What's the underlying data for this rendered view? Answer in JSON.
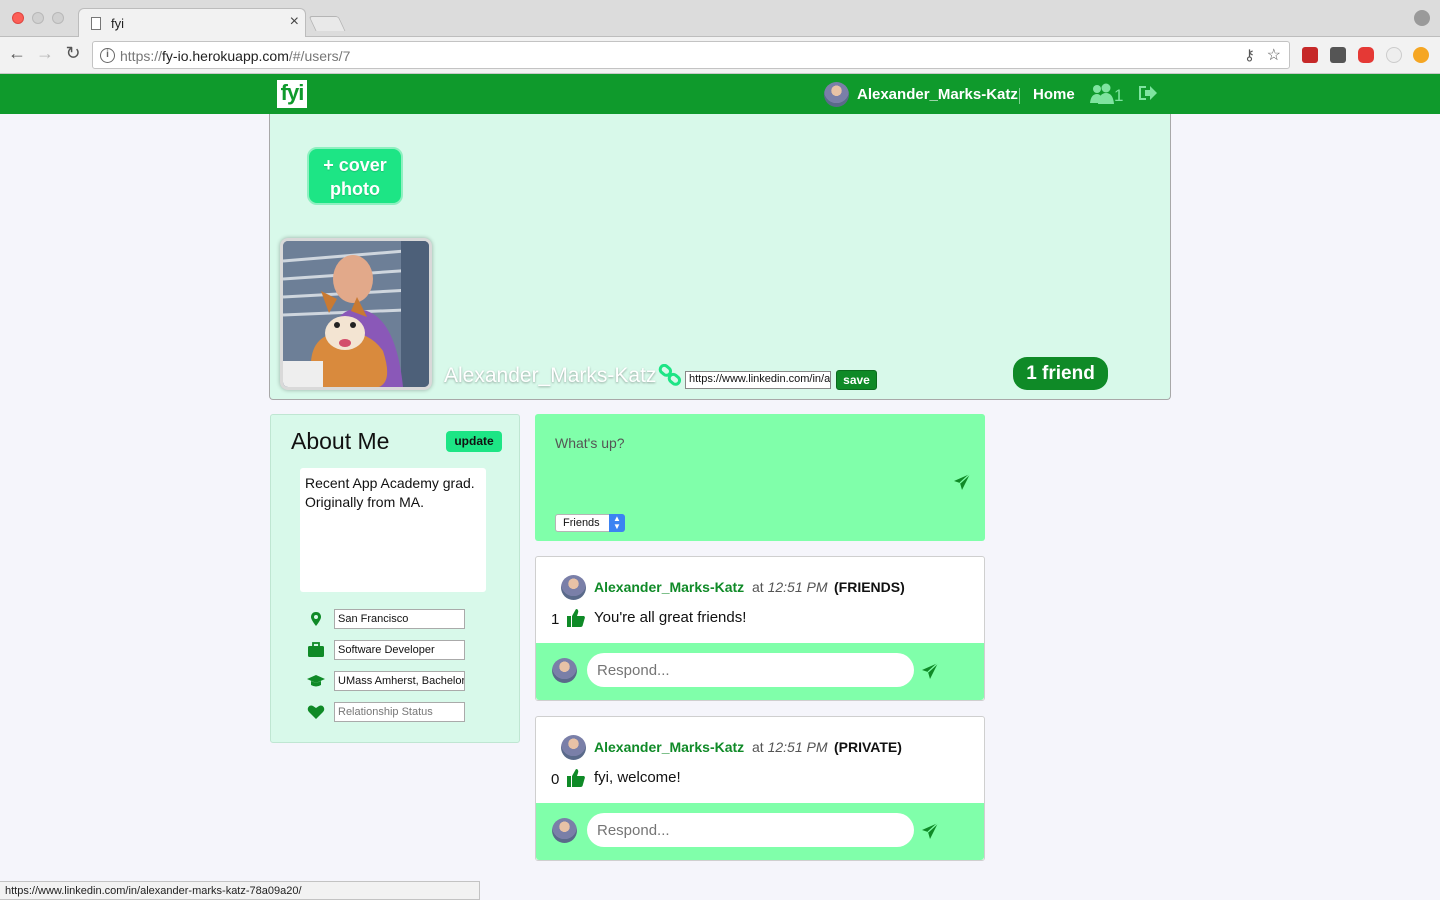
{
  "browser": {
    "tab_title": "fyi",
    "tab_close": "×",
    "url_scheme": "https://",
    "url_host": "fy-io.herokuapp.com",
    "url_path": "/#/users/7",
    "status_url": "https://www.linkedin.com/in/alexander-marks-katz-78a09a20/"
  },
  "nav": {
    "logo": "fyi",
    "username": "Alexander_Marks-Katz",
    "home": "Home",
    "friend_requests": "1"
  },
  "profile": {
    "cover_button": "+ cover photo",
    "name": "Alexander_Marks-Katz",
    "linkedin_value": "https://www.linkedin.com/in/alexander-marks-katz-78a09a20/",
    "save_label": "save",
    "friends_label": "1 friend"
  },
  "about": {
    "title": "About Me",
    "update_label": "update",
    "bio": "Recent App Academy grad. Originally from MA.",
    "location": "San Francisco",
    "work": "Software Developer",
    "education": "UMass Amherst, Bachelor",
    "relationship_placeholder": "Relationship Status"
  },
  "composer": {
    "placeholder": "What's up?",
    "audience": "Friends"
  },
  "posts": [
    {
      "author": "Alexander_Marks-Katz",
      "at": "at",
      "time": "12:51 PM",
      "visibility": "(FRIENDS)",
      "likes": "1",
      "body": "You're all great friends!",
      "reply_placeholder": "Respond..."
    },
    {
      "author": "Alexander_Marks-Katz",
      "at": "at",
      "time": "12:51 PM",
      "visibility": "(PRIVATE)",
      "likes": "0",
      "body": "fyi, welcome!",
      "reply_placeholder": "Respond..."
    }
  ],
  "colors": {
    "brand_green": "#0f9a2c",
    "accent_mint": "#1de585",
    "panel_green": "#80ffaa",
    "cover_bg": "#d8f9ea"
  }
}
